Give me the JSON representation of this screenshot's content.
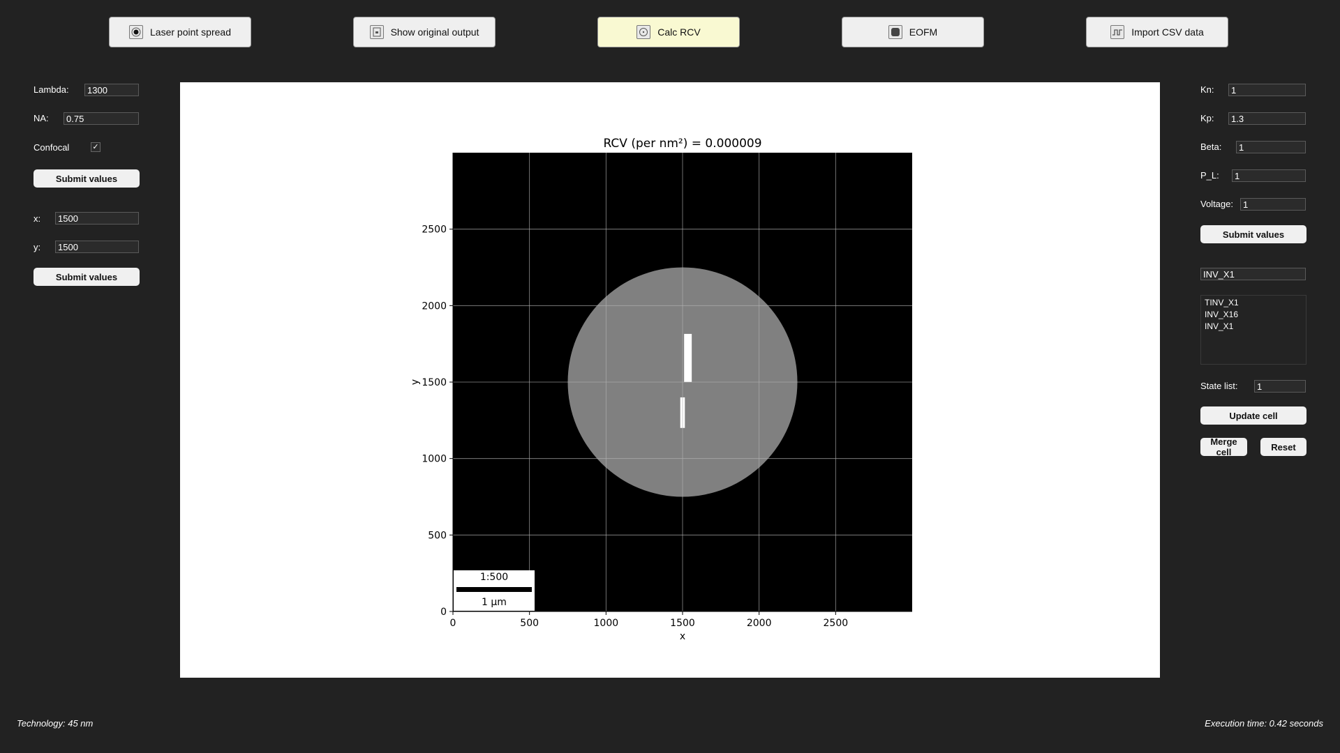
{
  "toolbar": {
    "buttons": [
      {
        "label": "Laser point spread",
        "icon": "laser-dot-icon"
      },
      {
        "label": "Show original output",
        "icon": "document-icon"
      },
      {
        "label": "Calc RCV",
        "icon": "calculator-icon",
        "active": true
      },
      {
        "label": "EOFM",
        "icon": "dark-square-icon"
      },
      {
        "label": "Import CSV data",
        "icon": "waveform-icon"
      }
    ],
    "active_color": "#f9f9d2"
  },
  "left_panel": {
    "lambda_label": "Lambda:",
    "lambda_value": "1300",
    "na_label": "NA:",
    "na_value": "0.75",
    "confocal_label": "Confocal",
    "confocal_checked": true,
    "submit_label_1": "Submit values",
    "x_label": "x:",
    "x_value": "1500",
    "y_label": "y:",
    "y_value": "1500",
    "submit_label_2": "Submit values"
  },
  "right_panel": {
    "kn_label": "Kn:",
    "kn_value": "1",
    "kp_label": "Kp:",
    "kp_value": "1.3",
    "beta_label": "Beta:",
    "beta_value": "1",
    "pl_label": "P_L:",
    "pl_value": "1",
    "voltage_label": "Voltage:",
    "voltage_value": "1",
    "submit_label": "Submit values",
    "cell_search_value": "INV_X1",
    "cell_list": [
      "TINV_X1",
      "INV_X16",
      "INV_X1"
    ],
    "state_list_label": "State list:",
    "state_list_value": "1",
    "update_cell_label": "Update cell",
    "merge_cell_label": "Merge cell",
    "reset_label": "Reset"
  },
  "chart_data": {
    "type": "heatmap",
    "title": "RCV (per nm²) = 0.000009",
    "xlabel": "x",
    "ylabel": "y",
    "xlim": [
      0,
      3000
    ],
    "ylim": [
      0,
      3000
    ],
    "xticks": [
      "0",
      "500",
      "1000",
      "1500",
      "2000",
      "2500"
    ],
    "yticks": [
      "0",
      "500",
      "1000",
      "1500",
      "2000",
      "2500"
    ],
    "grid": true,
    "background_color": "#000000",
    "spot": {
      "center_x": 1500,
      "center_y": 1500,
      "radius": 750,
      "color": "#808080"
    },
    "rectangles": [
      {
        "x0": 1510,
        "x1": 1560,
        "y0": 1500,
        "y1": 1815,
        "color": "#ffffff"
      },
      {
        "x0": 1485,
        "x1": 1515,
        "y0": 1200,
        "y1": 1400,
        "color": "#ffffff"
      }
    ],
    "scale_bar": {
      "ratio": "1:500",
      "unit": "1 µm"
    }
  },
  "footer": {
    "technology": "Technology: 45 nm",
    "execution_time": "Execution time: 0.42 seconds"
  }
}
